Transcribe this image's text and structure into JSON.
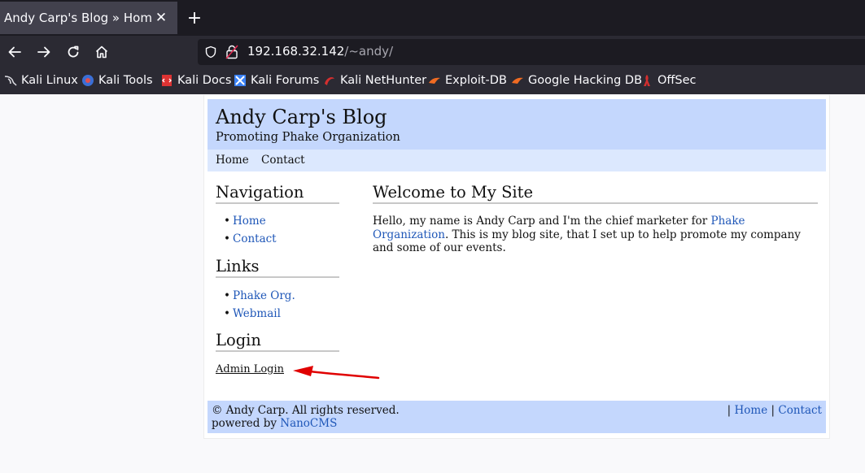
{
  "browser": {
    "tab": {
      "title": "Andy Carp's Blog » Home",
      "close_glyph": "✕"
    },
    "newtab_glyph": "+",
    "url": {
      "host": "192.168.32.142",
      "path": "/~andy/"
    },
    "bookmarks": [
      {
        "label": "Kali Linux",
        "icon": "kali-dragon-icon"
      },
      {
        "label": "Kali Tools",
        "icon": "kali-tools-icon"
      },
      {
        "label": "Kali Docs",
        "icon": "kali-docs-icon"
      },
      {
        "label": "Kali Forums",
        "icon": "kali-forums-icon"
      },
      {
        "label": "Kali NetHunter",
        "icon": "kali-nethunter-icon"
      },
      {
        "label": "Exploit-DB",
        "icon": "exploit-db-icon"
      },
      {
        "label": "Google Hacking DB",
        "icon": "ghdb-icon"
      },
      {
        "label": "OffSec",
        "icon": "offsec-icon"
      }
    ]
  },
  "site": {
    "title": "Andy Carp's Blog",
    "tagline": "Promoting Phake Organization",
    "topnav": [
      "Home",
      "Contact"
    ],
    "navigation": {
      "heading": "Navigation",
      "items": [
        "Home",
        "Contact"
      ]
    },
    "links": {
      "heading": "Links",
      "items": [
        "Phake Org.",
        "Webmail"
      ]
    },
    "login": {
      "heading": "Login",
      "link": "Admin Login"
    },
    "main": {
      "heading": "Welcome to My Site",
      "text_before": "Hello, my name is Andy Carp and I'm the chief marketer for ",
      "text_link": "Phake Organization",
      "text_after": ". This is my blog site, that I set up to help promote my company and some of our events."
    },
    "footer": {
      "copyright": "© Andy Carp. All rights reserved.",
      "powered_prefix": "powered by ",
      "powered_link": "NanoCMS",
      "separator": "|",
      "links": [
        "Home",
        "Contact"
      ]
    }
  },
  "colors": {
    "header_bg": "#c4d7fd",
    "nav_bg": "#dce8fe",
    "link": "#1f57b8",
    "annotation_arrow": "#e00000"
  }
}
